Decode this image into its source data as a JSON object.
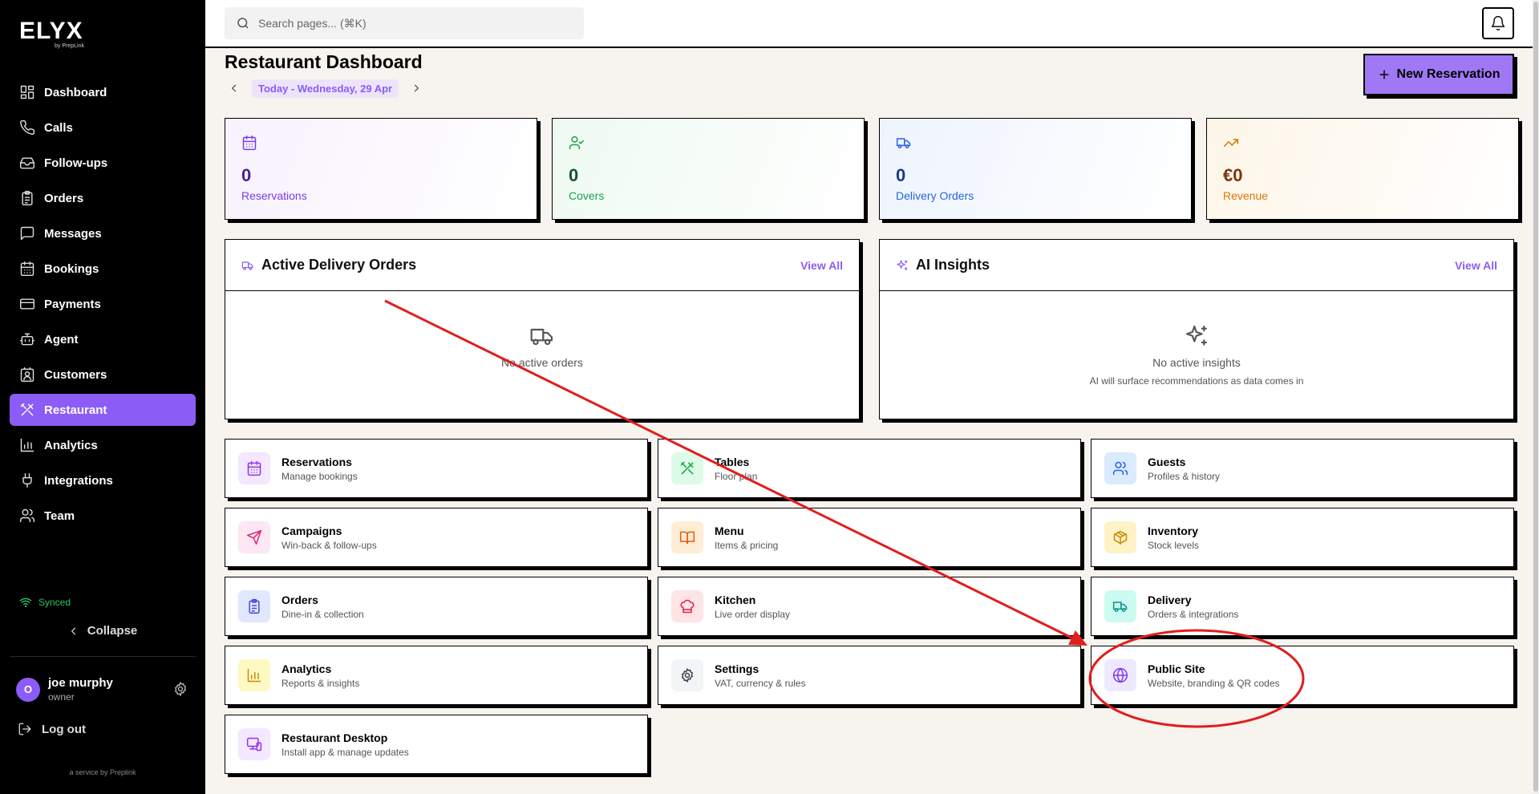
{
  "app": {
    "logo": "ELYX",
    "logo_sub": "by PrepLink"
  },
  "search": {
    "placeholder": "Search pages... (⌘K)"
  },
  "sidebar": {
    "items": [
      {
        "label": "Dashboard",
        "icon": "dashboard-icon"
      },
      {
        "label": "Calls",
        "icon": "phone-icon"
      },
      {
        "label": "Follow-ups",
        "icon": "inbox-icon"
      },
      {
        "label": "Orders",
        "icon": "clipboard-icon"
      },
      {
        "label": "Messages",
        "icon": "message-icon"
      },
      {
        "label": "Bookings",
        "icon": "calendar-icon"
      },
      {
        "label": "Payments",
        "icon": "credit-card-icon"
      },
      {
        "label": "Agent",
        "icon": "bot-icon"
      },
      {
        "label": "Customers",
        "icon": "contact-icon"
      },
      {
        "label": "Restaurant",
        "icon": "utensils-icon",
        "active": true
      },
      {
        "label": "Analytics",
        "icon": "bar-chart-icon"
      },
      {
        "label": "Integrations",
        "icon": "plug-icon"
      },
      {
        "label": "Team",
        "icon": "users-icon"
      }
    ],
    "synced": "Synced",
    "collapse": "Collapse",
    "user": {
      "initial": "O",
      "name": "joe murphy",
      "role": "owner"
    },
    "logout": "Log out",
    "service": "a service by Preplink"
  },
  "header": {
    "title": "Restaurant Dashboard",
    "date": "Today - Wednesday, 29 Apr",
    "new_button": "New Reservation"
  },
  "stats": [
    {
      "value": "0",
      "label": "Reservations",
      "icon": "calendar-icon",
      "color": "#7c3aed",
      "val_color": "#4c1d95",
      "bg": "#f7f2fd"
    },
    {
      "value": "0",
      "label": "Covers",
      "icon": "user-check-icon",
      "color": "#16a34a",
      "val_color": "#14532d",
      "bg": "#eefaf1"
    },
    {
      "value": "0",
      "label": "Delivery Orders",
      "icon": "truck-icon",
      "color": "#2563eb",
      "val_color": "#1e3a8a",
      "bg": "#eef4fd"
    },
    {
      "value": "€0",
      "label": "Revenue",
      "icon": "trending-up-icon",
      "color": "#d97706",
      "val_color": "#78350f",
      "bg": "#fdf6e8"
    }
  ],
  "panels": {
    "delivery": {
      "title": "Active Delivery Orders",
      "view_all": "View All",
      "empty": "No active orders"
    },
    "insights": {
      "title": "AI Insights",
      "view_all": "View All",
      "empty": "No active insights",
      "empty_sub": "AI will surface recommendations as data comes in"
    }
  },
  "tiles": [
    {
      "title": "Reservations",
      "sub": "Manage bookings",
      "icon": "calendar-icon",
      "color": "#9333ea",
      "bg": "#f3e8ff"
    },
    {
      "title": "Tables",
      "sub": "Floor plan",
      "icon": "utensils-icon",
      "color": "#16a34a",
      "bg": "#dcfce7"
    },
    {
      "title": "Guests",
      "sub": "Profiles & history",
      "icon": "users-icon",
      "color": "#2563eb",
      "bg": "#dbeafe"
    },
    {
      "title": "Campaigns",
      "sub": "Win-back & follow-ups",
      "icon": "send-icon",
      "color": "#db2777",
      "bg": "#fce7f3"
    },
    {
      "title": "Menu",
      "sub": "Items & pricing",
      "icon": "book-icon",
      "color": "#ea580c",
      "bg": "#ffedd5"
    },
    {
      "title": "Inventory",
      "sub": "Stock levels",
      "icon": "package-icon",
      "color": "#ca8a04",
      "bg": "#fef3c7"
    },
    {
      "title": "Orders",
      "sub": "Dine-in & collection",
      "icon": "clipboard-icon",
      "color": "#4f46e5",
      "bg": "#e0e7ff"
    },
    {
      "title": "Kitchen",
      "sub": "Live order display",
      "icon": "chef-hat-icon",
      "color": "#e11d48",
      "bg": "#ffe4e6"
    },
    {
      "title": "Delivery",
      "sub": "Orders & integrations",
      "icon": "truck-icon",
      "color": "#0d9488",
      "bg": "#ccfbf1"
    },
    {
      "title": "Analytics",
      "sub": "Reports & insights",
      "icon": "bar-chart-icon",
      "color": "#ca8a04",
      "bg": "#fef9c3"
    },
    {
      "title": "Settings",
      "sub": "VAT, currency & rules",
      "icon": "gear-icon",
      "color": "#374151",
      "bg": "#f3f4f6"
    },
    {
      "title": "Public Site",
      "sub": "Website, branding & QR codes",
      "icon": "globe-icon",
      "color": "#7c3aed",
      "bg": "#ede9fe"
    },
    {
      "title": "Restaurant Desktop",
      "sub": "Install app & manage updates",
      "icon": "monitor-icon",
      "color": "#9333ea",
      "bg": "#f3e8ff"
    }
  ],
  "annotation_color": "#e11d1d"
}
